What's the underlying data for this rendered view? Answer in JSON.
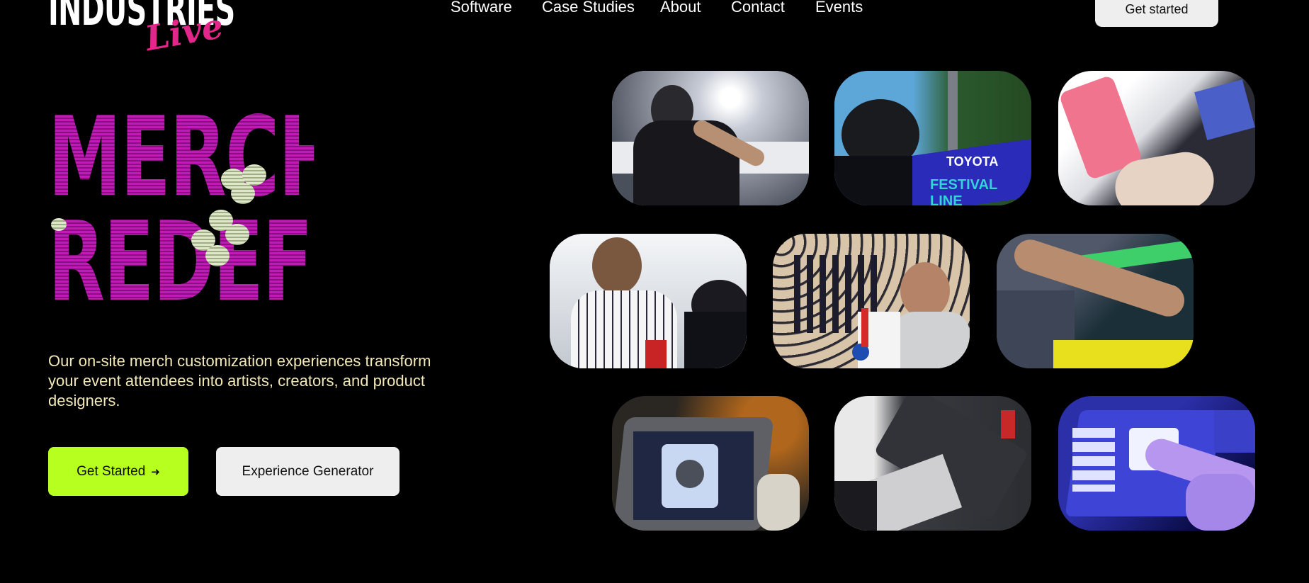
{
  "header": {
    "logo_text": "INDUSTRIES",
    "logo_script": "Live",
    "nav": [
      "Software",
      "Case Studies",
      "About",
      "Contact",
      "Events"
    ],
    "cta_label": "Get started"
  },
  "hero": {
    "title_line1": "MERCH",
    "title_line2": "REDEFINED",
    "description": "Our on-site merch customization experiences transform your event attendees into artists, creators, and product designers.",
    "primary_button": "Get Started",
    "primary_arrow": "➜",
    "secondary_button": "Experience Generator"
  },
  "gallery": {
    "tile_4_text": "TOYOTA",
    "tile_4_subtext": "FESTIVAL LINE"
  },
  "colors": {
    "background": "#000000",
    "headline": "#c21ab7",
    "accent_green": "#b7ff1f",
    "description": "#f3e8b8",
    "logo_script": "#e2268a"
  }
}
